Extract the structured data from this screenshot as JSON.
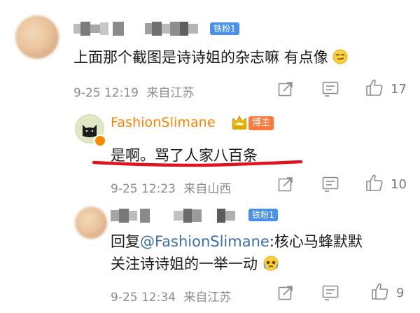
{
  "comments": [
    {
      "text": "上面那个截图是诗诗姐的杂志嘛 有点像",
      "time": "9-25 12:19",
      "location": "来自江苏",
      "likes": "17",
      "fan_badge": "铁粉1"
    },
    {
      "user_name": "FashionSlimane",
      "role_badge": "博主",
      "text": "是啊。骂了人家八百条",
      "time": "9-25 12:23",
      "location": "来自山西",
      "likes": "10"
    },
    {
      "fan_badge": "铁粉1",
      "reply_prefix": "回复",
      "reply_mention": "@FashionSlimane",
      "reply_text_line1": ":核心马蜂默默",
      "reply_text_line2": "关注诗诗姐的一举一动",
      "time": "9-25 12:34",
      "location": "来自江苏",
      "likes": "9"
    }
  ],
  "colors": {
    "username": "#ff8200",
    "mention": "#3c6ea8",
    "underline": "#e0141e",
    "fan_badge": "#4a90e8",
    "host_badge": "#ff7a3d",
    "meta_text": "#8c8c8c"
  },
  "icons": {
    "share": "share-icon",
    "comment": "comment-icon",
    "like": "thumbs-up-icon",
    "crown": "crown-icon"
  }
}
